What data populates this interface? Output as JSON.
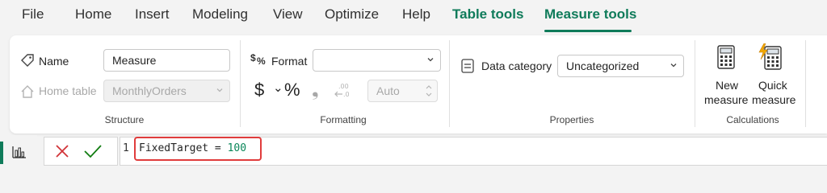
{
  "menu": {
    "file": "File",
    "home": "Home",
    "insert": "Insert",
    "modeling": "Modeling",
    "view": "View",
    "optimize": "Optimize",
    "help": "Help",
    "table_tools": "Table tools",
    "measure_tools": "Measure tools",
    "active_tab": "Measure tools"
  },
  "structure": {
    "name_label": "Name",
    "name_value": "Measure",
    "home_table_label": "Home table",
    "home_table_value": "MonthlyOrders",
    "group_label": "Structure"
  },
  "formatting": {
    "format_label": "Format",
    "format_value": "",
    "currency_symbol": "$",
    "currency_chevron": "⌄",
    "percent_symbol": "%",
    "comma_symbol": "❟",
    "decimals_value": "Auto",
    "group_label": "Formatting"
  },
  "properties": {
    "data_category_label": "Data category",
    "data_category_value": "Uncategorized",
    "group_label": "Properties"
  },
  "calculations": {
    "new_measure_line1": "New",
    "new_measure_line2": "measure",
    "quick_measure_line1": "Quick",
    "quick_measure_line2": "measure",
    "group_label": "Calculations"
  },
  "formula_bar": {
    "line_number": "1",
    "code_text": "FixedTarget = ",
    "code_number": "100"
  },
  "colors": {
    "accent": "#0f7b5a",
    "highlight_border": "#e03c3c",
    "cancel": "#d13438",
    "commit": "#107c10"
  }
}
